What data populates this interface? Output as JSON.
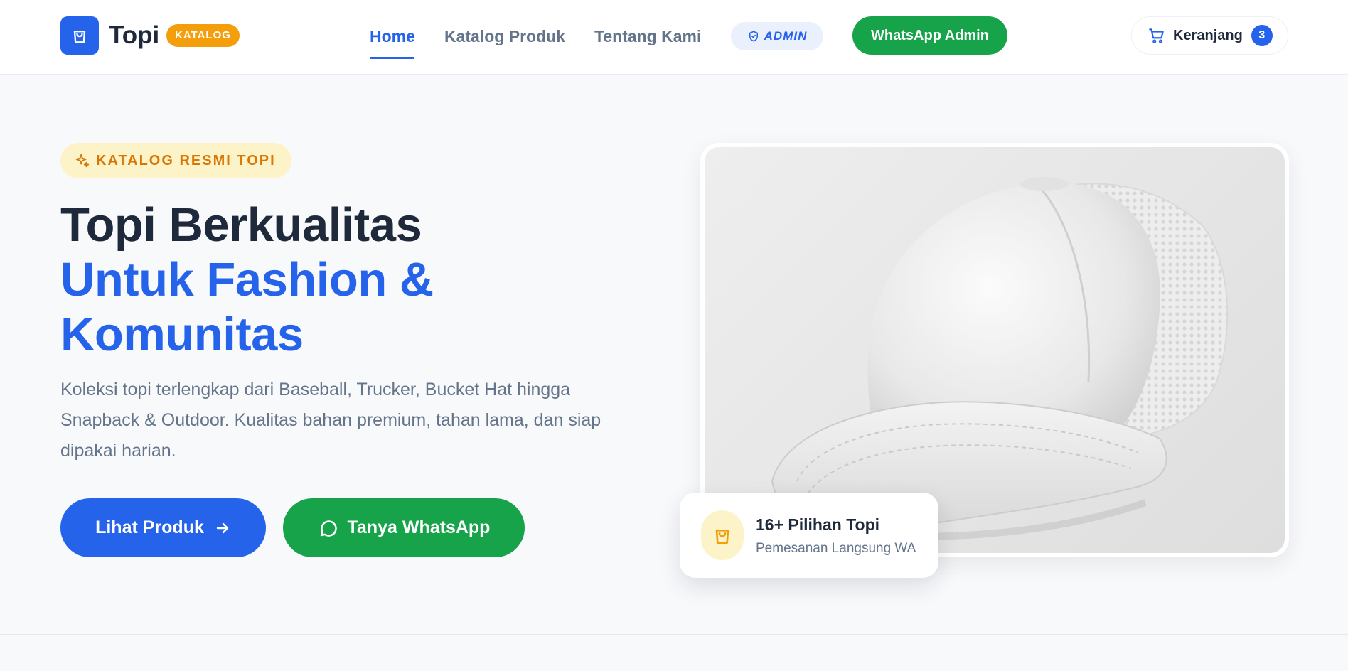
{
  "navbar": {
    "logo_text": "Topi",
    "logo_badge": "KATALOG",
    "links": [
      {
        "label": "Home",
        "active": true
      },
      {
        "label": "Katalog Produk",
        "active": false
      },
      {
        "label": "Tentang Kami",
        "active": false
      }
    ],
    "admin_label": "ADMIN",
    "whatsapp_label": "WhatsApp Admin",
    "cart_label": "Keranjang",
    "cart_count": "3"
  },
  "hero": {
    "badge": "KATALOG RESMI TOPI",
    "title_line1": "Topi Berkualitas",
    "title_line2": "Untuk Fashion &",
    "title_line3": "Komunitas",
    "description": "Koleksi topi terlengkap dari Baseball, Trucker, Bucket Hat hingga Snapback & Outdoor. Kualitas bahan premium, tahan lama, dan siap dipakai harian.",
    "primary_button": "Lihat Produk",
    "secondary_button": "Tanya WhatsApp"
  },
  "stat_card": {
    "title": "16+ Pilihan Topi",
    "subtitle": "Pemesanan Langsung WA"
  },
  "icons": {
    "logo": "shopping-bag-icon",
    "admin": "shield-check-icon",
    "cart": "cart-icon",
    "badge": "sparkles-icon",
    "arrow": "arrow-right-icon",
    "whatsapp": "chat-bubble-icon",
    "stat": "shopping-bag-icon"
  },
  "colors": {
    "primary": "#2563eb",
    "green": "#16a34a",
    "amber": "#f59e0b",
    "dark": "#1e293b",
    "muted": "#64748b"
  }
}
